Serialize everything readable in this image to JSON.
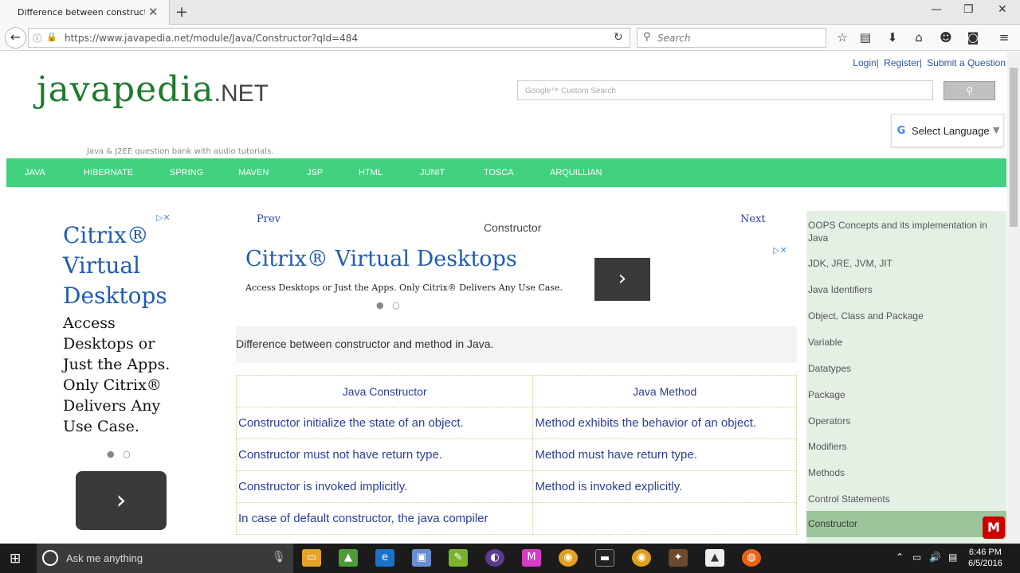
{
  "browser": {
    "tab_title": "Difference between construct...",
    "url": "https://www.javapedia.net/module/Java/Constructor?qId=484",
    "search_placeholder": "Search"
  },
  "site": {
    "logo_main": "javapedia",
    "logo_suffix": ".NET",
    "tagline": "Java & J2EE question bank with audio tutorials.",
    "top_links": [
      "Login|",
      "Register|",
      "Submit a Question"
    ],
    "google_search_placeholder": "Google™ Custom Search",
    "select_language": "Select Language",
    "nav": [
      "JAVA",
      "HIBERNATE",
      "SPRING",
      "MAVEN",
      "JSP",
      "HTML",
      "JUNIT",
      "TOSCA",
      "ARQUILLIAN"
    ]
  },
  "ad_left": {
    "title": "Citrix® Virtual Desktops",
    "body": "Access Desktops or Just the Apps. Only Citrix® Delivers Any Use Case."
  },
  "ad_center": {
    "title": "Citrix® Virtual Desktops",
    "body": "Access Desktops or Just the Apps. Only Citrix® Delivers Any Use Case."
  },
  "content": {
    "prev": "Prev",
    "next": "Next",
    "topic": "Constructor",
    "question": "Difference between constructor and method in Java.",
    "table_headers": [
      "Java Constructor",
      "Java Method"
    ],
    "table_rows": [
      [
        "Constructor initialize the state of an object.",
        "Method exhibits the behavior of an object."
      ],
      [
        "Constructor must not have return type.",
        "Method must have return type."
      ],
      [
        "Constructor is invoked implicitly.",
        "Method is invoked explicitly."
      ],
      [
        "In case of default constructor, the java compiler",
        ""
      ]
    ]
  },
  "sidebar": {
    "items": [
      "OOPS Concepts and its implementation in Java",
      "JDK, JRE, JVM, JIT",
      "Java Identifiers",
      "Object, Class and Package",
      "Variable",
      "Datatypes",
      "Package",
      "Operators",
      "Modifiers",
      "Methods",
      "Control Statements",
      "Constructor"
    ],
    "active_index": 11
  },
  "taskbar": {
    "search_placeholder": "Ask me anything",
    "time": "6:46 PM",
    "date": "6/5/2016"
  },
  "colors": {
    "nav_green": "#40d17e",
    "link_blue": "#2a3e9a",
    "sidebar_bg": "#e4f0e4",
    "sidebar_active": "#9cc59c"
  }
}
